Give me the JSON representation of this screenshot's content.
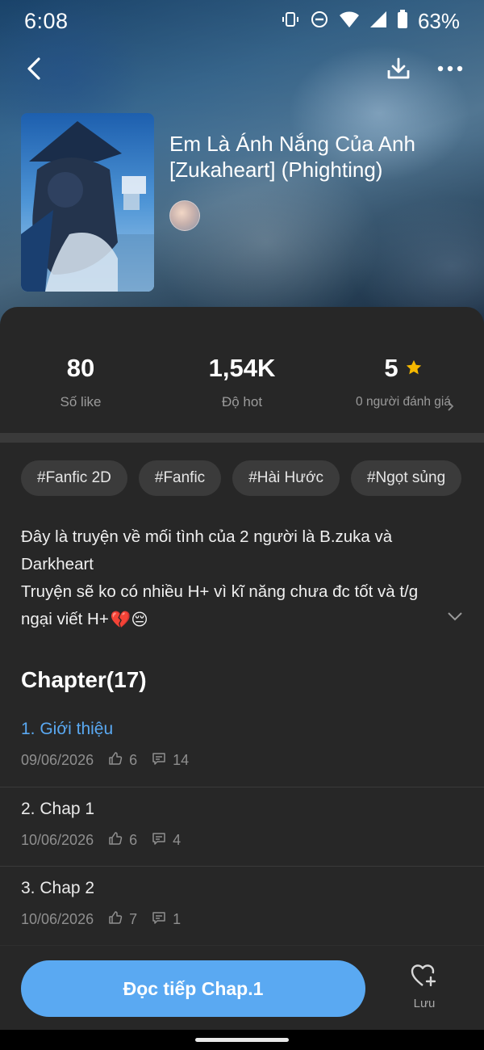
{
  "status_bar": {
    "time": "6:08",
    "battery": "63%",
    "icons": [
      "vibrate-icon",
      "dnd-icon",
      "wifi-icon",
      "signal-icon",
      "battery-icon"
    ]
  },
  "topbar": {
    "icons": [
      "back-arrow-icon",
      "download-icon",
      "more-icon"
    ]
  },
  "book": {
    "title": "Em Là Ánh Nắng Của Anh [Zukaheart] (Phighting)"
  },
  "stats": [
    {
      "value": "80",
      "label": "Số like"
    },
    {
      "value": "1,54K",
      "label": "Độ hot"
    },
    {
      "value": "5",
      "label": "0 người đánh giá",
      "icon": "star-icon"
    }
  ],
  "tags": [
    "#Fanfic 2D",
    "#Fanfic",
    "#Hài Hước",
    "#Ngọt sủng"
  ],
  "description": {
    "line1": "Đây là truyện về mối tình của 2 người là B.zuka và Darkheart",
    "line2": "Truyện sẽ ko có nhiều H+ vì kĩ năng chưa đc tốt và t/g ngại viết H+",
    "emoji": "💔😔"
  },
  "chapters_heading": "Chapter(17)",
  "chapters": [
    {
      "title": "1. Giới thiệu",
      "date": "09/06/2026",
      "likes": "6",
      "comments": "14"
    },
    {
      "title": "2. Chap 1",
      "date": "10/06/2026",
      "likes": "6",
      "comments": "4"
    },
    {
      "title": "3. Chap 2",
      "date": "10/06/2026",
      "likes": "7",
      "comments": "1"
    }
  ],
  "actions": {
    "read_label": "Đọc tiếp Chap.1",
    "save_label": "Lưu"
  },
  "colors": {
    "accent": "#5aa9f2",
    "sheet_bg": "#272727",
    "star": "#f5b800"
  }
}
